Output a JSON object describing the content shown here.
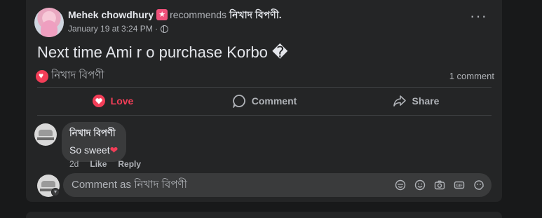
{
  "post": {
    "author": "Mehek chowdhury",
    "recommends": "recommends",
    "page": "নিখাদ বিপণী.",
    "timestamp": "January 19 at 3:24 PM ·",
    "text": "Next time Ami r o purchase Korbo �",
    "reaction_name": "নিখাদ বিপণী",
    "comment_count": "1 comment"
  },
  "actions": {
    "love": "Love",
    "comment": "Comment",
    "share": "Share"
  },
  "comment": {
    "author": "নিখাদ বিপণী",
    "text": "So sweet",
    "emoji": "❤",
    "age": "2d",
    "like": "Like",
    "reply": "Reply"
  },
  "composer": {
    "placeholder": "Comment as নিখাদ বিপণী"
  },
  "colors": {
    "background": "#18191a",
    "card": "#242526",
    "bubble": "#3a3b3c",
    "love": "#f33e58"
  },
  "icons": {
    "more": "more-options-icon",
    "privacy": "globe-icon",
    "badge": "recommend-badge-icon"
  }
}
